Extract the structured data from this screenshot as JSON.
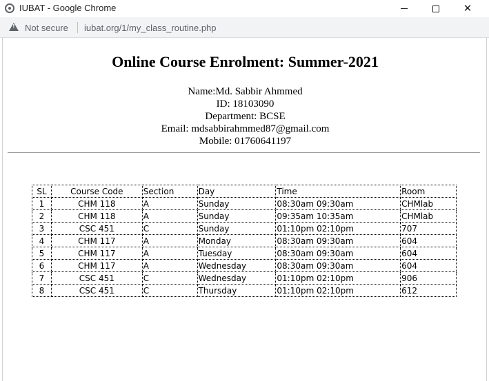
{
  "window": {
    "title": "IUBAT - Google Chrome",
    "minimize_icon": "minimize-icon",
    "maximize_icon": "maximize-icon",
    "close_icon": "close-icon"
  },
  "address_bar": {
    "security_label": "Not secure",
    "url": "iubat.org/1/my_class_routine.php"
  },
  "page": {
    "title": "Online Course Enrolment: Summer-2021",
    "name": "Name:Md. Sabbir Ahmmed",
    "id": "ID: 18103090",
    "department": "Department: BCSE",
    "email": "Email: mdsabbirahmmed87@gmail.com",
    "mobile": "Mobile: 01760641197"
  },
  "table": {
    "headers": [
      "SL",
      "Course Code",
      "Section",
      "Day",
      "Time",
      "Room"
    ],
    "rows": [
      [
        "1",
        "CHM 118",
        "A",
        "Sunday",
        "08:30am 09:30am",
        "CHMlab"
      ],
      [
        "2",
        "CHM 118",
        "A",
        "Sunday",
        "09:35am 10:35am",
        "CHMlab"
      ],
      [
        "3",
        "CSC 451",
        "C",
        "Sunday",
        "01:10pm 02:10pm",
        "707"
      ],
      [
        "4",
        "CHM 117",
        "A",
        "Monday",
        "08:30am 09:30am",
        "604"
      ],
      [
        "5",
        "CHM 117",
        "A",
        "Tuesday",
        "08:30am 09:30am",
        "604"
      ],
      [
        "6",
        "CHM 117",
        "A",
        "Wednesday",
        "08:30am 09:30am",
        "604"
      ],
      [
        "7",
        "CSC 451",
        "C",
        "Wednesday",
        "01:10pm 02:10pm",
        "906"
      ],
      [
        "8",
        "CSC 451",
        "C",
        "Thursday",
        "01:10pm 02:10pm",
        "612"
      ]
    ]
  }
}
